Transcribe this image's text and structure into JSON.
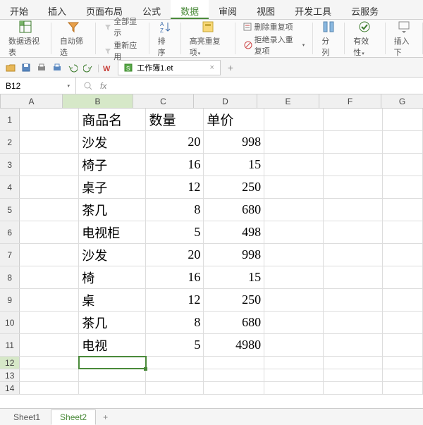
{
  "tabs": [
    "开始",
    "插入",
    "页面布局",
    "公式",
    "数据",
    "审阅",
    "视图",
    "开发工具",
    "云服务"
  ],
  "active_tab_index": 4,
  "ribbon": {
    "pivot": "数据透视表",
    "autofilter": "自动筛选",
    "show_all": "全部显示",
    "reapply": "重新应用",
    "sort": "排序",
    "highlight_dup": "高亮重复项",
    "remove_dup": "删除重复项",
    "reject_dup": "拒绝录入重复项",
    "text_to_cols": "分列",
    "validation": "有效性",
    "insert_dd": "插入下"
  },
  "doc_tab": {
    "name": "工作簿1.et"
  },
  "namebox": "B12",
  "columns": [
    "A",
    "B",
    "C",
    "D",
    "E",
    "F",
    "G"
  ],
  "selected_col": "B",
  "selected_row": 12,
  "data_rows": [
    {
      "r": 1,
      "B": "商品名",
      "C": "数量",
      "D": "单价",
      "header": true
    },
    {
      "r": 2,
      "B": "沙发",
      "C": "20",
      "D": "998"
    },
    {
      "r": 3,
      "B": "椅子",
      "C": "16",
      "D": "15"
    },
    {
      "r": 4,
      "B": "桌子",
      "C": "12",
      "D": "250"
    },
    {
      "r": 5,
      "B": "茶几",
      "C": "8",
      "D": "680"
    },
    {
      "r": 6,
      "B": "电视柜",
      "C": "5",
      "D": "498"
    },
    {
      "r": 7,
      "B": "沙发",
      "C": "20",
      "D": "998"
    },
    {
      "r": 8,
      "B": "椅",
      "C": "16",
      "D": "15"
    },
    {
      "r": 9,
      "B": "桌",
      "C": "12",
      "D": "250"
    },
    {
      "r": 10,
      "B": "茶几",
      "C": "8",
      "D": "680"
    },
    {
      "r": 11,
      "B": "电视",
      "C": "5",
      "D": "4980"
    }
  ],
  "empty_rows": [
    12,
    13,
    14
  ],
  "sheets": [
    "Sheet1",
    "Sheet2"
  ],
  "active_sheet_index": 1
}
